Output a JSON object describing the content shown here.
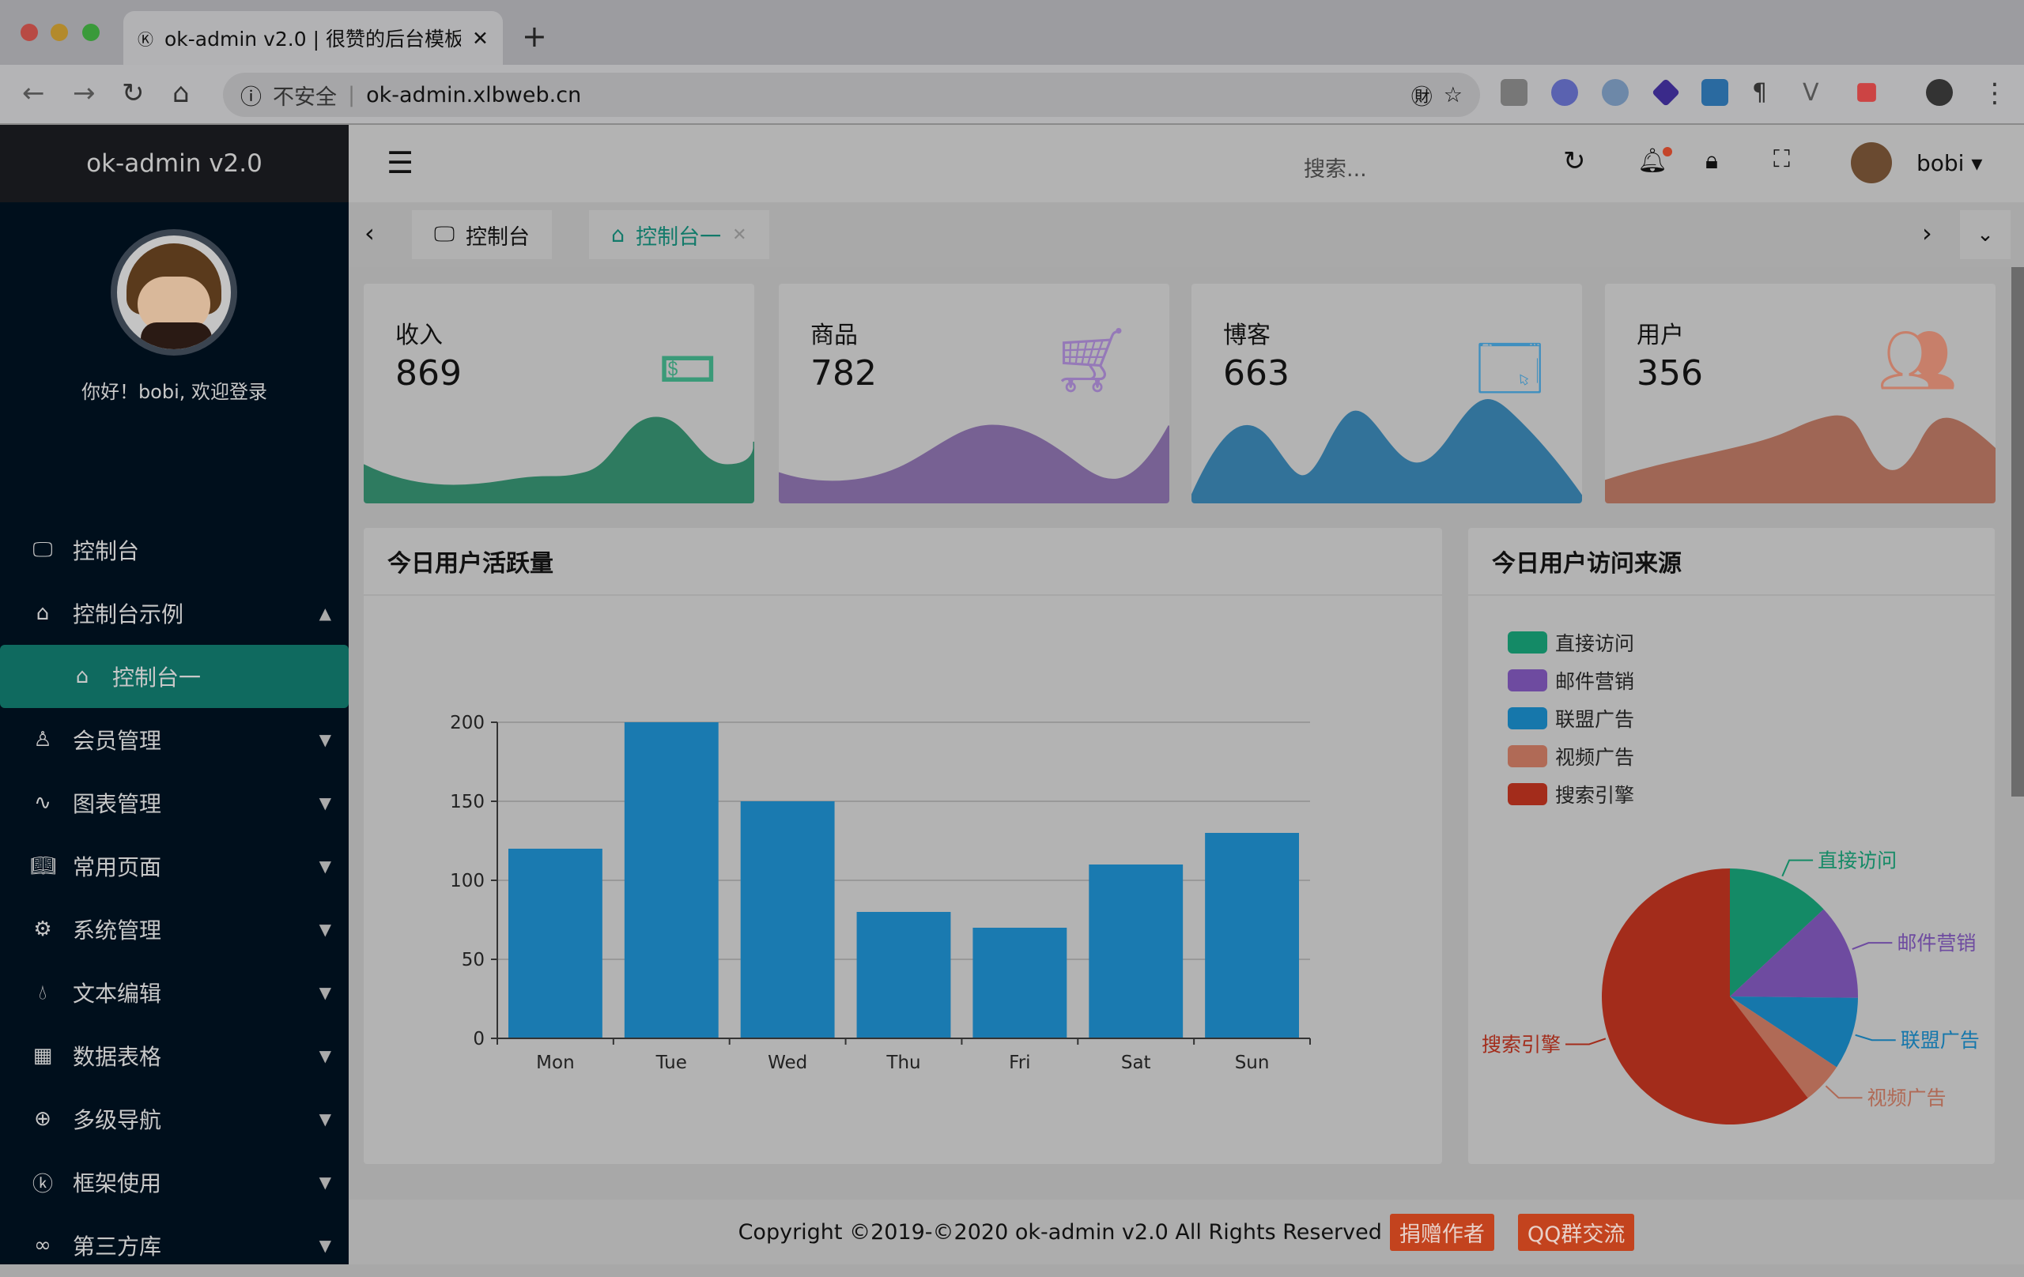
{
  "browser": {
    "tab_title": "ok-admin v2.0 | 很赞的后台模板",
    "security": "不安全",
    "url": "ok-admin.xlbweb.cn"
  },
  "sidebar": {
    "logo": "ok-admin v2.0",
    "welcome": "你好！bobi, 欢迎登录",
    "items": [
      {
        "label": "控制台",
        "icon": "monitor-icon"
      },
      {
        "label": "控制台示例",
        "icon": "home-icon",
        "expanded": true
      },
      {
        "label": "控制台一",
        "icon": "home-icon",
        "active": true
      },
      {
        "label": "会员管理",
        "icon": "user-icon"
      },
      {
        "label": "图表管理",
        "icon": "pulse-icon"
      },
      {
        "label": "常用页面",
        "icon": "book-icon"
      },
      {
        "label": "系统管理",
        "icon": "gear-icon"
      },
      {
        "label": "文本编辑",
        "icon": "drops-icon"
      },
      {
        "label": "数据表格",
        "icon": "table-icon"
      },
      {
        "label": "多级导航",
        "icon": "plus-circle-icon"
      },
      {
        "label": "框架使用",
        "icon": "ok-icon"
      },
      {
        "label": "第三方库",
        "icon": "infinity-icon"
      }
    ]
  },
  "header": {
    "search_placeholder": "搜索...",
    "username": "bobi"
  },
  "tabs": [
    {
      "label": "控制台"
    },
    {
      "label": "控制台一",
      "active": true
    }
  ],
  "cards": [
    {
      "label": "收入",
      "value": "869",
      "color": "#3a9a78"
    },
    {
      "label": "商品",
      "value": "782",
      "color": "#9579b8"
    },
    {
      "label": "博客",
      "value": "663",
      "color": "#3f8fbf"
    },
    {
      "label": "用户",
      "value": "356",
      "color": "#c77f6a"
    }
  ],
  "bar_panel": {
    "title": "今日用户活跃量"
  },
  "pie_panel": {
    "title": "今日用户访问来源"
  },
  "chart_data": [
    {
      "type": "bar",
      "categories": [
        "Mon",
        "Tue",
        "Wed",
        "Thu",
        "Fri",
        "Sat",
        "Sun"
      ],
      "values": [
        120,
        200,
        150,
        80,
        70,
        110,
        130
      ],
      "ylim": [
        0,
        200
      ],
      "yticks": [
        "0",
        "50",
        "100",
        "150",
        "200"
      ],
      "grid": true,
      "color": "#1a7ab0"
    },
    {
      "type": "pie",
      "legend_position": "top-left",
      "slices": [
        {
          "name": "直接访问",
          "value": 335,
          "color": "#148a66"
        },
        {
          "name": "邮件营销",
          "value": 310,
          "color": "#6e4ba0"
        },
        {
          "name": "联盟广告",
          "value": 234,
          "color": "#1677ab"
        },
        {
          "name": "视频广告",
          "value": 135,
          "color": "#b06a56"
        },
        {
          "name": "搜索引擎",
          "value": 1548,
          "color": "#a32c1b"
        }
      ]
    }
  ],
  "footer": {
    "copyright": "Copyright ©2019-©2020 ok-admin v2.0 All Rights Reserved",
    "donate": "捐赠作者",
    "qq": "QQ群交流"
  }
}
